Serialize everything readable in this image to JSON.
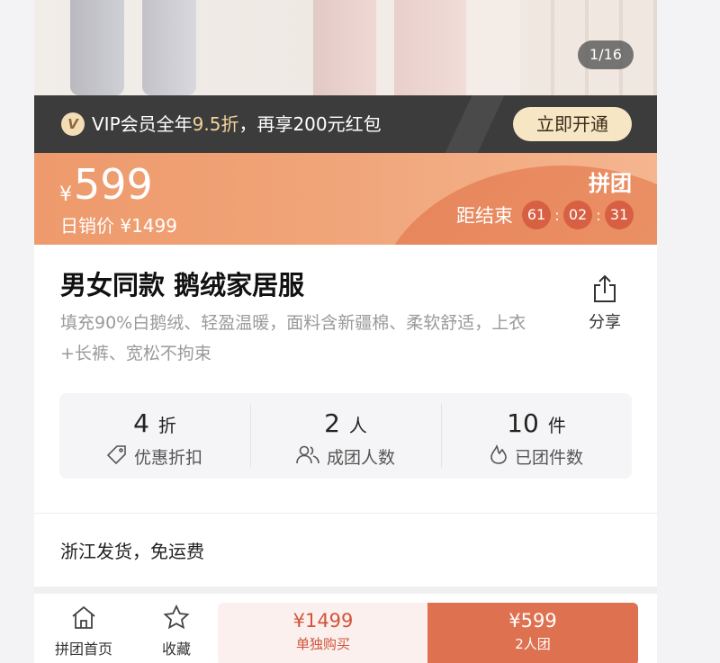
{
  "gallery": {
    "counter": "1/16"
  },
  "vip": {
    "badge": "V",
    "text_pre": "VIP会员全年",
    "text_highlight": "9.5折",
    "text_post": "，再享200元红包",
    "button": "立即开通",
    "highlight_color": "#f2d39a"
  },
  "price": {
    "currency": "¥",
    "amount": "599",
    "daily_label": "日销价",
    "daily_price": "¥1499",
    "group_label": "拼团",
    "countdown_label": "距结束",
    "countdown": [
      "61",
      "02",
      "31"
    ],
    "countdown_sep": ":"
  },
  "product": {
    "title": "男女同款 鹅绒家居服",
    "description": "填充90%白鹅绒、轻盈温暖，面料含新疆棉、柔软舒适，上衣+长裤、宽松不拘束",
    "share_label": "分享"
  },
  "stats": [
    {
      "value": "4",
      "unit": "折",
      "label": "优惠折扣",
      "icon": "tag-icon"
    },
    {
      "value": "2",
      "unit": "人",
      "label": "成团人数",
      "icon": "people-icon"
    },
    {
      "value": "10",
      "unit": "件",
      "label": "已团件数",
      "icon": "flame-icon"
    }
  ],
  "shipping": "浙江发货，免运费",
  "bottom_bar": {
    "home_label": "拼团首页",
    "favorite_label": "收藏",
    "single_price": "¥1499",
    "single_label": "单独购买",
    "group_price": "¥599",
    "group_label": "2人团"
  },
  "colors": {
    "accent": "#de7150",
    "price_banner": "#ee9a6c",
    "vip_bar": "#3c3c3c",
    "countdown_box": "#d75f42"
  }
}
